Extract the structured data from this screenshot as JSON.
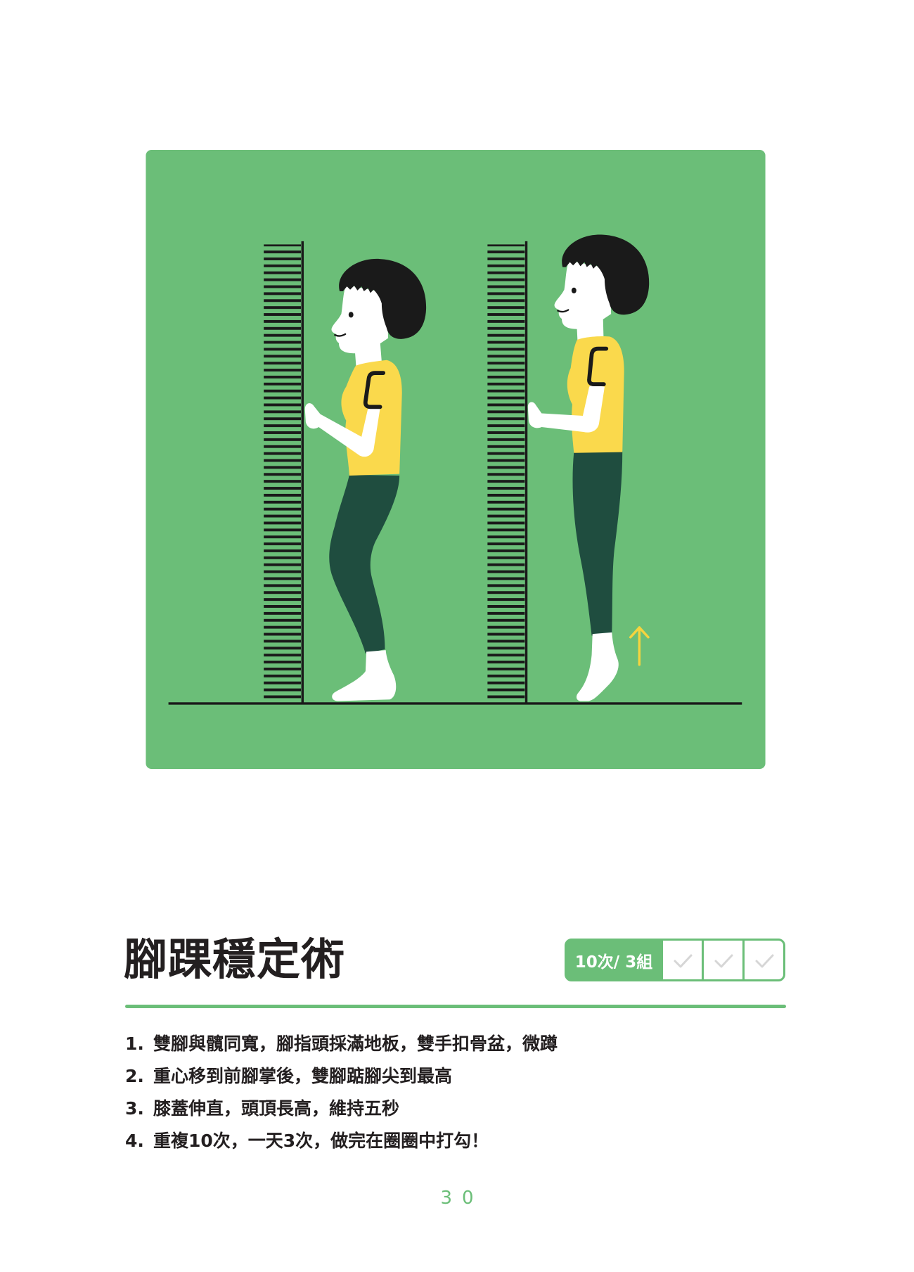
{
  "colors": {
    "accent": "#6BBE78",
    "shirt": "#FAD94C",
    "pants": "#1F4D3F",
    "ink": "#1A1A1A",
    "arrow": "#F5D43F",
    "text": "#231F20"
  },
  "illustration": {
    "arrow_icon": "arrow-up-icon"
  },
  "exercise": {
    "title": "腳踝穩定術",
    "badge": {
      "label": "10次/ 3組",
      "checkboxes": [
        {
          "icon": "check-icon",
          "checked": false
        },
        {
          "icon": "check-icon",
          "checked": false
        },
        {
          "icon": "check-icon",
          "checked": false
        }
      ]
    },
    "steps": [
      {
        "num": "1.",
        "text": "雙腳與髖同寬，腳指頭採滿地板，雙手扣骨盆，微蹲"
      },
      {
        "num": "2.",
        "text": "重心移到前腳掌後，雙腳踮腳尖到最高"
      },
      {
        "num": "3.",
        "text": "膝蓋伸直，頭頂長高，維持五秒"
      },
      {
        "num": "4.",
        "text": "重複10次，一天3次，做完在圈圈中打勾！"
      }
    ]
  },
  "page": {
    "number": "30"
  }
}
